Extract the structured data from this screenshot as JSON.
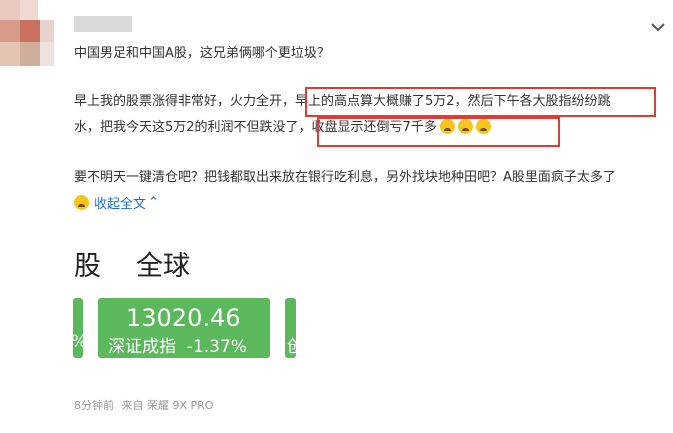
{
  "post": {
    "title": "中国男足和中国A股，这兄弟俩哪个更垃圾？",
    "line1_a": "早上我的股票涨得非常好，火力全开，",
    "line1_b": "早上的高点算大概赚了5万2，然后下午各大股指纷纷跳",
    "line2_a": "水，把我今天这5万2的利润不但跌没了，",
    "line2_b": "收盘显示还倒亏7千多",
    "line3": "要不明天一键清仓吧？把钱都取出来放在银行吃利息，另外找块地种田吧？A股里面疯子太多了",
    "collapse_label": "收起全文",
    "collapse_arrow": "⌃"
  },
  "image": {
    "tab_left": "股",
    "tab_right": "全球",
    "card_main_value": "13020.46",
    "card_main_label": "深证成指  -1.37%",
    "card_left_fragment": "%",
    "card_right_fragment": "创",
    "card_color": "#5cb85c"
  },
  "footer": {
    "time": "8分钟前",
    "source": "来自 荣耀 9X PRO"
  },
  "icons": {
    "expand": "chevron-down-icon",
    "emoji": "crying-face-icon"
  },
  "colors": {
    "highlight": "#e53935",
    "link": "#1e6fd9"
  }
}
